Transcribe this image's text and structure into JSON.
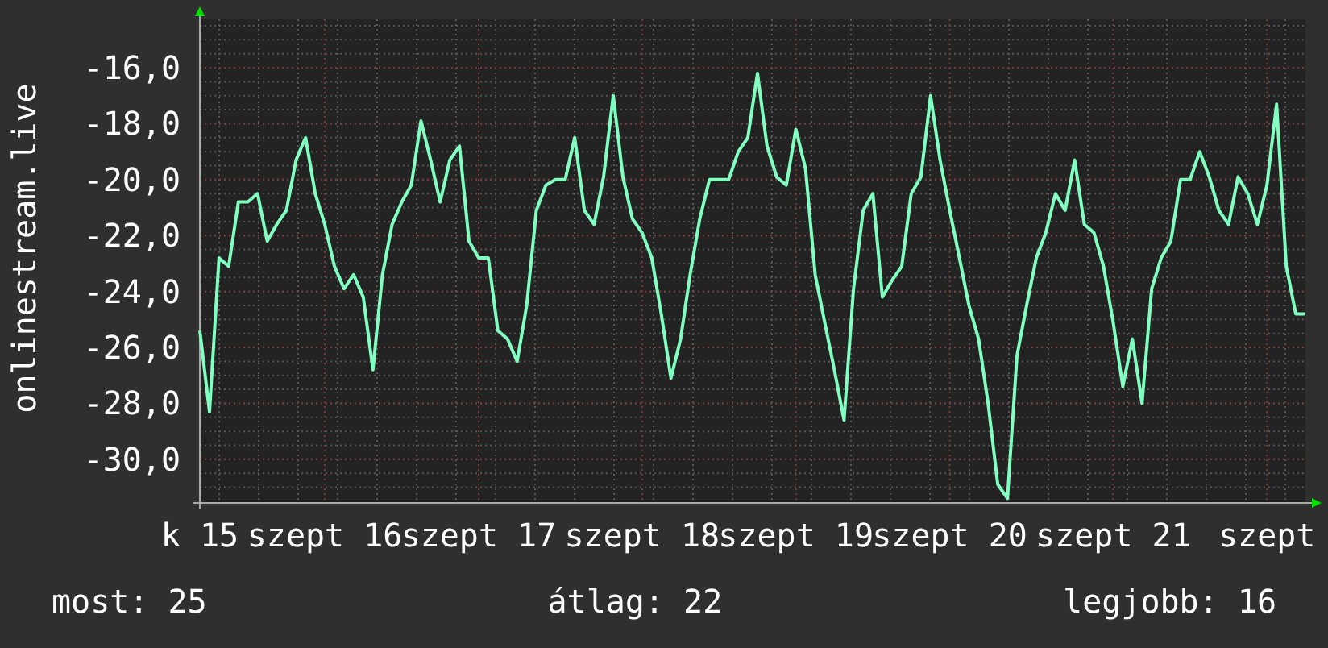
{
  "chart": {
    "chart_data": {
      "type": "line",
      "ylabel": "onlinestream.live",
      "grid": true,
      "ylim": [
        -31.56,
        -14.27
      ],
      "categories": [
        "k 15",
        null,
        null,
        null,
        null,
        null,
        null,
        null,
        null,
        null,
        null,
        null,
        null,
        "szept 16",
        null,
        null,
        null,
        null,
        null,
        null,
        null,
        null,
        null,
        null,
        null,
        null,
        null,
        null,
        null,
        "szept 17",
        null,
        null,
        null,
        null,
        null,
        null,
        null,
        null,
        null,
        null,
        null,
        null,
        null,
        null,
        null,
        null,
        "szept 18",
        null,
        null,
        null,
        null,
        null,
        null,
        null,
        null,
        null,
        null,
        null,
        null,
        null,
        null,
        null,
        "szept 19",
        null,
        null,
        null,
        null,
        null,
        null,
        null,
        null,
        null,
        null,
        null,
        null,
        null,
        null,
        null,
        "szept 20",
        null,
        null,
        null,
        null,
        null,
        null,
        null,
        null,
        null,
        null,
        null,
        null,
        null,
        null,
        null,
        null,
        "szept 21",
        null,
        null,
        null,
        null,
        null,
        null,
        null,
        null,
        null,
        null,
        null,
        null,
        null,
        null,
        null,
        "szept",
        null,
        null,
        null,
        null
      ],
      "yticks": [
        {
          "value": -16,
          "label": "-16,0"
        },
        {
          "value": -18,
          "label": "-18,0"
        },
        {
          "value": -20,
          "label": "-20,0"
        },
        {
          "value": -22,
          "label": "-22,0"
        },
        {
          "value": -24,
          "label": "-24,0"
        },
        {
          "value": -26,
          "label": "-26,0"
        },
        {
          "value": -28,
          "label": "-28,0"
        },
        {
          "value": -30,
          "label": "-30,0"
        }
      ],
      "series": [
        {
          "color": "#80ffc0",
          "values": [
            -25.4,
            -28.3,
            -22.8,
            -23.1,
            -20.8,
            -20.8,
            -20.5,
            -22.2,
            -21.6,
            -21.1,
            -19.3,
            -18.5,
            -20.5,
            -21.6,
            -23.1,
            -23.9,
            -23.4,
            -24.2,
            -26.8,
            -23.4,
            -21.6,
            -20.8,
            -20.2,
            -17.9,
            -19.3,
            -20.8,
            -19.3,
            -18.8,
            -22.2,
            -22.8,
            -22.8,
            -25.4,
            -25.7,
            -26.5,
            -24.5,
            -21.1,
            -20.2,
            -20.0,
            -20.0,
            -18.5,
            -21.1,
            -21.6,
            -19.9,
            -17.0,
            -19.9,
            -21.4,
            -21.9,
            -22.8,
            -24.8,
            -27.1,
            -25.7,
            -23.4,
            -21.4,
            -20.0,
            -20.0,
            -20.0,
            -19.0,
            -18.5,
            -16.2,
            -18.8,
            -19.9,
            -20.2,
            -18.2,
            -19.6,
            -23.4,
            -25.1,
            -26.8,
            -28.6,
            -23.9,
            -21.1,
            -20.5,
            -24.2,
            -23.6,
            -23.1,
            -20.5,
            -19.9,
            -17.0,
            -19.3,
            -21.1,
            -22.8,
            -24.5,
            -25.7,
            -28.0,
            -30.9,
            -31.4,
            -26.3,
            -24.5,
            -22.8,
            -21.9,
            -20.5,
            -21.1,
            -19.3,
            -21.6,
            -21.9,
            -23.1,
            -25.1,
            -27.4,
            -25.7,
            -28.0,
            -23.9,
            -22.8,
            -22.2,
            -20.0,
            -20.0,
            -19.0,
            -19.9,
            -21.1,
            -21.6,
            -19.9,
            -20.5,
            -21.6,
            -20.2,
            -17.3,
            -23.1,
            -24.8,
            -24.8
          ]
        }
      ]
    }
  },
  "stats": [
    {
      "label": "most: 25"
    },
    {
      "label": "átlag: 22"
    },
    {
      "label": "legjobb: 16"
    }
  ]
}
